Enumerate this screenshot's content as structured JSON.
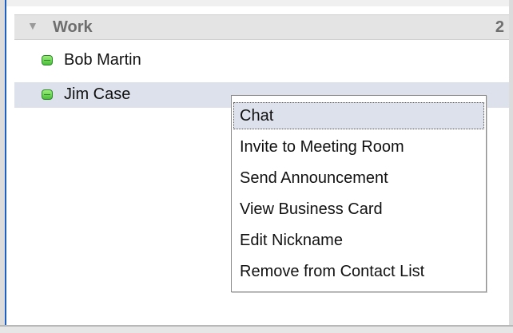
{
  "group": {
    "name": "Work",
    "count": "2",
    "arrow_icon": "triangle-down-icon"
  },
  "contacts": [
    {
      "name": "Bob Martin",
      "status": "online",
      "status_color": "#4bbd3a",
      "selected": false
    },
    {
      "name": "Jim Case",
      "status": "online",
      "status_color": "#4bbd3a",
      "selected": true
    }
  ],
  "context_menu": {
    "items": [
      {
        "label": "Chat",
        "highlighted": true
      },
      {
        "label": "Invite to Meeting Room",
        "highlighted": false
      },
      {
        "label": "Send Announcement",
        "highlighted": false
      },
      {
        "label": "View Business Card",
        "highlighted": false
      },
      {
        "label": "Edit Nickname",
        "highlighted": false
      },
      {
        "label": "Remove from Contact List",
        "highlighted": false
      }
    ]
  },
  "colors": {
    "selection": "#dce1ec",
    "group_header_bg": "#e4e4e4",
    "online": "#4bbd3a",
    "frame_accent": "#1f5fbf"
  }
}
